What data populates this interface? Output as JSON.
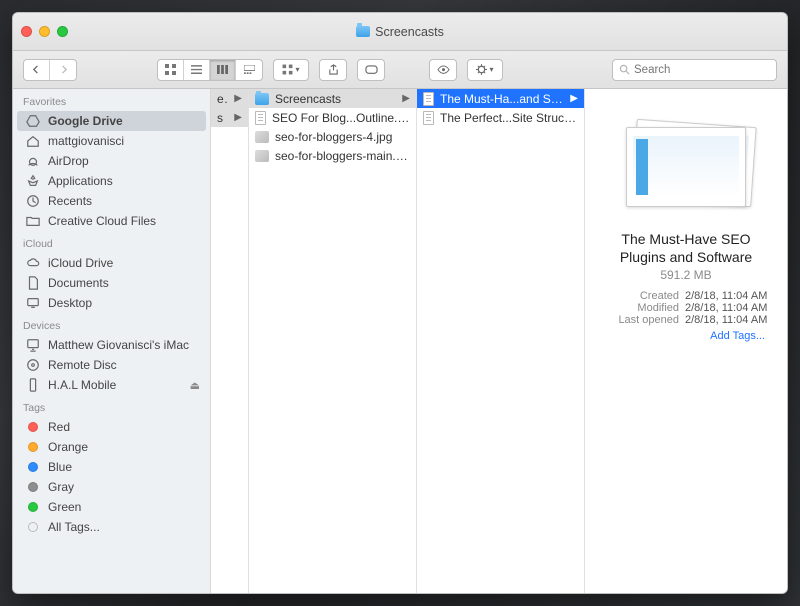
{
  "window": {
    "title": "Screencasts"
  },
  "search": {
    "placeholder": "Search"
  },
  "sidebar": {
    "sections": [
      {
        "header": "Favorites",
        "items": [
          {
            "icon": "gdrive",
            "label": "Google Drive",
            "selected": true
          },
          {
            "icon": "home",
            "label": "mattgiovanisci"
          },
          {
            "icon": "airdrop",
            "label": "AirDrop"
          },
          {
            "icon": "apps",
            "label": "Applications"
          },
          {
            "icon": "recents",
            "label": "Recents"
          },
          {
            "icon": "folder",
            "label": "Creative Cloud Files"
          }
        ]
      },
      {
        "header": "iCloud",
        "items": [
          {
            "icon": "cloud",
            "label": "iCloud Drive"
          },
          {
            "icon": "doc",
            "label": "Documents"
          },
          {
            "icon": "desktop",
            "label": "Desktop"
          }
        ]
      },
      {
        "header": "Devices",
        "items": [
          {
            "icon": "imac",
            "label": "Matthew Giovanisci's iMac"
          },
          {
            "icon": "disc",
            "label": "Remote Disc"
          },
          {
            "icon": "phone",
            "label": "H.A.L Mobile",
            "eject": true
          }
        ]
      },
      {
        "header": "Tags",
        "items": [
          {
            "icon": "tag",
            "color": "#ff5f57",
            "label": "Red"
          },
          {
            "icon": "tag",
            "color": "#ffab2e",
            "label": "Orange"
          },
          {
            "icon": "tag",
            "color": "#2e8cff",
            "label": "Blue"
          },
          {
            "icon": "tag",
            "color": "#8e8e8e",
            "label": "Gray"
          },
          {
            "icon": "tag",
            "color": "#28c940",
            "label": "Green"
          },
          {
            "icon": "tag",
            "color": "transparent",
            "label": "All Tags..."
          }
        ]
      }
    ]
  },
  "columns": {
    "c0": {
      "peek": [
        {
          "label": "ers",
          "arrow": true
        },
        {
          "label": "s",
          "arrow": true
        }
      ]
    },
    "c1": {
      "items": [
        {
          "type": "folder",
          "label": "Screencasts",
          "arrow": true,
          "path": true
        },
        {
          "type": "doc",
          "label": "SEO For Blog...Outline.gdoc"
        },
        {
          "type": "img",
          "label": "seo-for-bloggers-4.jpg"
        },
        {
          "type": "img",
          "label": "seo-for-bloggers-main.jpg"
        }
      ]
    },
    "c2": {
      "items": [
        {
          "type": "doc",
          "label": "The Must-Ha...and Software",
          "arrow": true,
          "sel": true
        },
        {
          "type": "doc",
          "label": "The Perfect...Site Structure"
        }
      ]
    }
  },
  "preview": {
    "title": "The Must-Have SEO Plugins and Software",
    "size": "591.2 MB",
    "meta": [
      {
        "k": "Created",
        "v": "2/8/18, 11:04 AM"
      },
      {
        "k": "Modified",
        "v": "2/8/18, 11:04 AM"
      },
      {
        "k": "Last opened",
        "v": "2/8/18, 11:04 AM"
      }
    ],
    "addTags": "Add Tags..."
  }
}
